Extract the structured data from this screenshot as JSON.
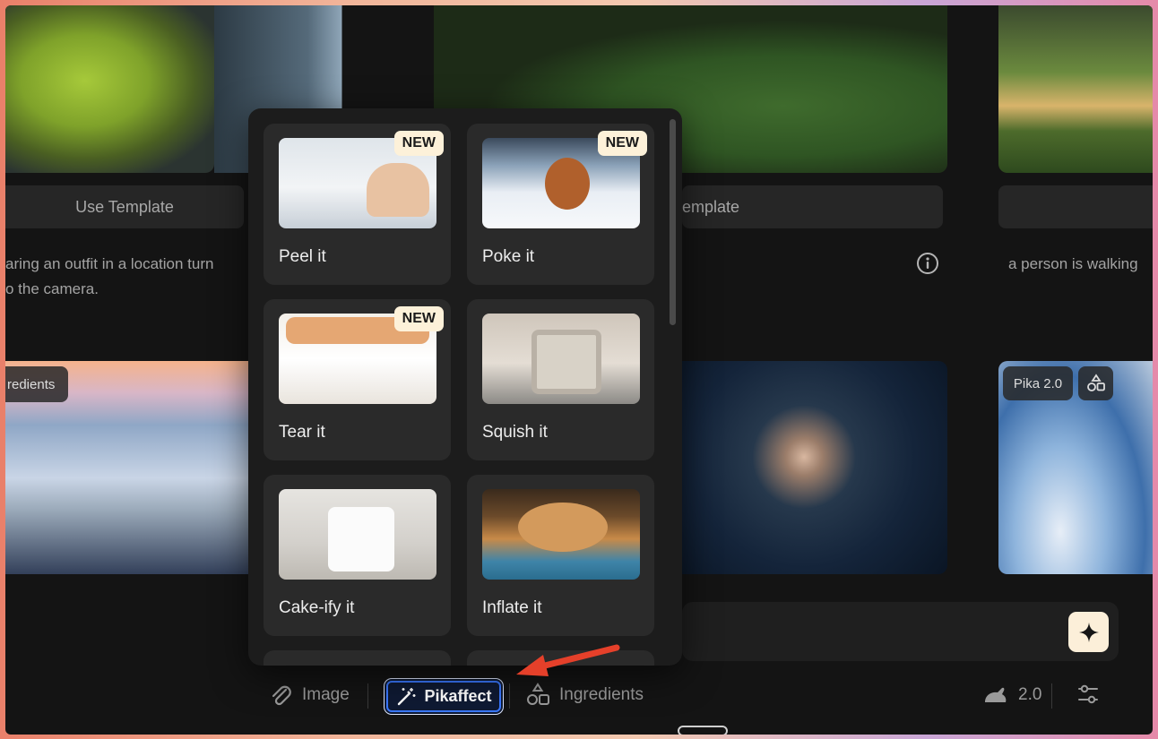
{
  "gallery": {
    "use_template_label": "Use Template",
    "use_template_partial": "emplate",
    "caption_left_line1": "aring an outfit in a location turn",
    "caption_left_line2": "o the camera.",
    "caption_right": "a person is walking",
    "chip_ingredients": "redients",
    "chip_model": "Pika 2.0"
  },
  "popup": {
    "cards": [
      {
        "label": "Peel it",
        "badge": "NEW"
      },
      {
        "label": "Poke it",
        "badge": "NEW"
      },
      {
        "label": "Tear it",
        "badge": "NEW"
      },
      {
        "label": "Squish it"
      },
      {
        "label": "Cake-ify it"
      },
      {
        "label": "Inflate it"
      }
    ]
  },
  "toolbar": {
    "image_label": "Image",
    "pikaffect_label": "Pikaffect",
    "ingredients_label": "Ingredients",
    "model_version": "2.0"
  },
  "colors": {
    "accent_border": "#3a78ff",
    "badge_bg": "#fdf1d9",
    "generate_bg": "#fcefd9",
    "arrow": "#e5402a"
  }
}
